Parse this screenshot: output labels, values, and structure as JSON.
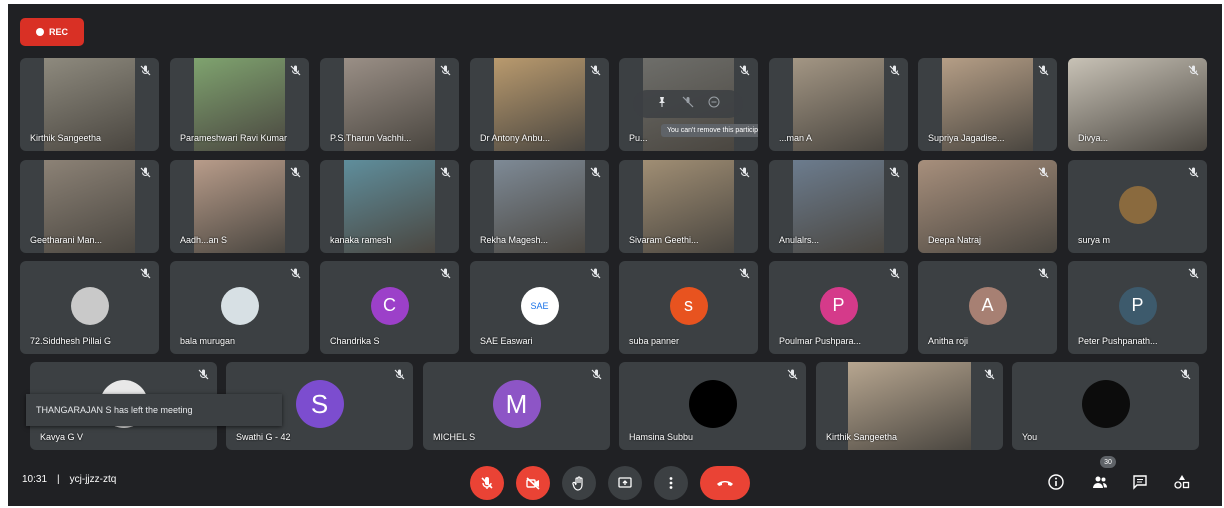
{
  "rec_label": "REC",
  "meeting": {
    "time": "10:31",
    "separator": "|",
    "code": "ycj-jjzz-ztq"
  },
  "toast_text": "THANGARAJAN S has left the meeting",
  "hover_tooltip": "You can't remove this participant",
  "participant_count": "30",
  "colors": {
    "background": "#202124",
    "tile": "#3c4043",
    "rec": "#d93025",
    "red_button": "#ea4335"
  },
  "participants": [
    {
      "name": "Kirthik Sangeetha",
      "avatar": ""
    },
    {
      "name": "Parameshwari Ravi Kumar",
      "avatar": ""
    },
    {
      "name": "P.S.Tharun Vachhi...",
      "avatar": ""
    },
    {
      "name": "Dr Antony Anbu...",
      "avatar": ""
    },
    {
      "name": "Pu...",
      "avatar": ""
    },
    {
      "name": "...man A",
      "avatar": ""
    },
    {
      "name": "Supriya Jagadise...",
      "avatar": ""
    },
    {
      "name": "Divya...",
      "avatar": ""
    },
    {
      "name": "Geetharani Man...",
      "avatar": ""
    },
    {
      "name": "Aadh...an S",
      "avatar": ""
    },
    {
      "name": "kanaka ramesh",
      "avatar": ""
    },
    {
      "name": "Rekha Magesh...",
      "avatar": ""
    },
    {
      "name": "Sivaram Geethi...",
      "avatar": ""
    },
    {
      "name": "Anulalrs...",
      "avatar": ""
    },
    {
      "name": "Deepa Natraj",
      "avatar": ""
    },
    {
      "name": "surya m",
      "avatar": ""
    },
    {
      "name": "72.Siddhesh Pillai G",
      "avatar": ""
    },
    {
      "name": "bala murugan",
      "avatar": ""
    },
    {
      "name": "Chandrika S",
      "avatar": "C"
    },
    {
      "name": "SAE Easwari",
      "avatar": "SAE"
    },
    {
      "name": "suba panner",
      "avatar": "s"
    },
    {
      "name": "Poulmar Pushpara...",
      "avatar": "P"
    },
    {
      "name": "Anitha roji",
      "avatar": "A"
    },
    {
      "name": "Peter Pushpanath...",
      "avatar": "P"
    },
    {
      "name": "Kavya G V",
      "avatar": ""
    },
    {
      "name": "Swathi G - 42",
      "avatar": "S"
    },
    {
      "name": "MICHEL S",
      "avatar": "M"
    },
    {
      "name": "Hamsina Subbu",
      "avatar": ""
    },
    {
      "name": "Kirthik Sangeetha",
      "avatar": ""
    },
    {
      "name": "You",
      "avatar": ""
    }
  ],
  "controls": [
    {
      "name": "mic-off-button",
      "icon": "mic-off-icon"
    },
    {
      "name": "camera-off-button",
      "icon": "camera-off-icon"
    },
    {
      "name": "raise-hand-button",
      "icon": "hand-icon"
    },
    {
      "name": "present-button",
      "icon": "present-icon"
    },
    {
      "name": "more-options-button",
      "icon": "more-vert-icon"
    },
    {
      "name": "end-call-button",
      "icon": "phone-hangup-icon"
    }
  ],
  "right_controls": [
    {
      "name": "meeting-info-button",
      "icon": "info-icon"
    },
    {
      "name": "people-button",
      "icon": "people-icon"
    },
    {
      "name": "chat-button",
      "icon": "chat-icon"
    },
    {
      "name": "activities-button",
      "icon": "shapes-icon"
    }
  ]
}
